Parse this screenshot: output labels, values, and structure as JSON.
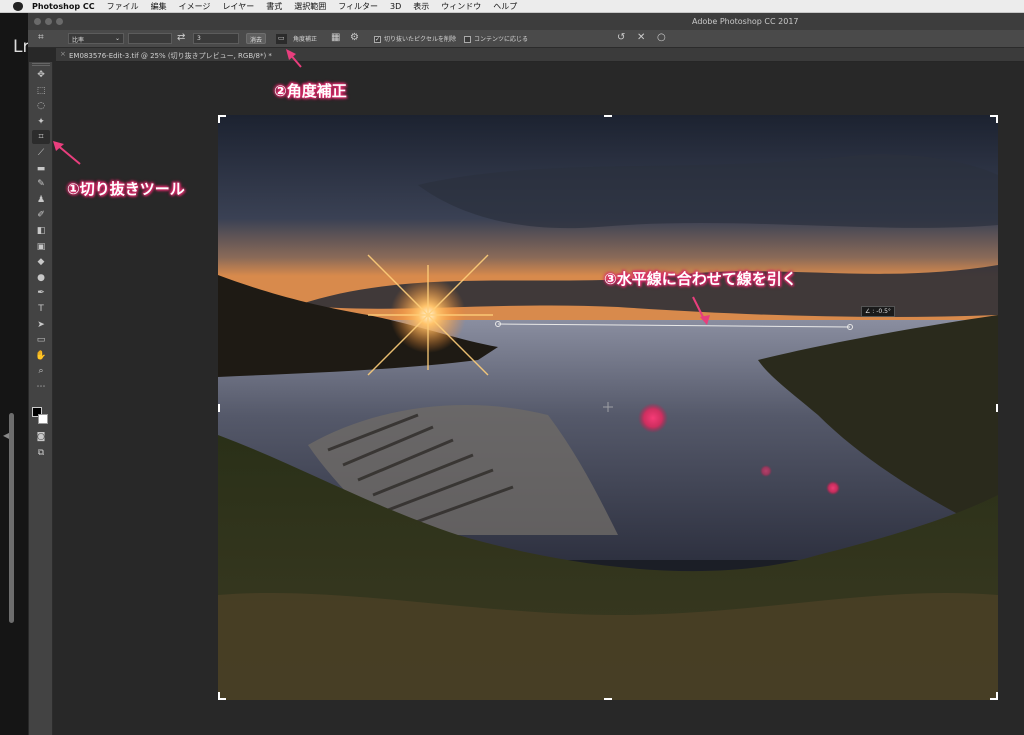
{
  "menubar": {
    "app_name": "Photoshop CC",
    "items": [
      "ファイル",
      "編集",
      "イメージ",
      "レイヤー",
      "書式",
      "選択範囲",
      "フィルター",
      "3D",
      "表示",
      "ウィンドウ",
      "ヘルプ"
    ]
  },
  "window": {
    "title": "Adobe Photoshop CC 2017"
  },
  "lightroom": {
    "label": "Lr"
  },
  "options_bar": {
    "ratio_select": "比率",
    "width_value": "",
    "height_value": "3",
    "clear_button": "消去",
    "straighten_label": "角度補正",
    "delete_cropped_label": "切り抜いたピクセルを削除",
    "delete_cropped_checked": true,
    "content_aware_label": "コンテンツに応じる",
    "content_aware_checked": false
  },
  "document_tab": {
    "title": "EM083576-Edit-3.tif @ 25% (切り抜きプレビュー, RGB/8*) *"
  },
  "canvas": {
    "angle_readout": "∠ : -0.5°"
  },
  "annotations": {
    "crop_tool": "①切り抜きツール",
    "straighten": "②角度補正",
    "draw_line": "③水平線に合わせて線を引く"
  },
  "colors": {
    "annotation_pink": "#e83e7d",
    "ui_dark": "#282828",
    "toolbar": "#434343"
  },
  "tools": [
    "move-icon",
    "marquee-icon",
    "lasso-icon",
    "magic-wand-icon",
    "crop-icon",
    "eyedropper-icon",
    "healing-brush-icon",
    "brush-icon",
    "clone-stamp-icon",
    "history-brush-icon",
    "eraser-icon",
    "gradient-icon",
    "blur-icon",
    "dodge-icon",
    "pen-icon",
    "type-icon",
    "path-select-icon",
    "rectangle-icon",
    "hand-icon",
    "zoom-icon",
    "more-tools-icon"
  ]
}
